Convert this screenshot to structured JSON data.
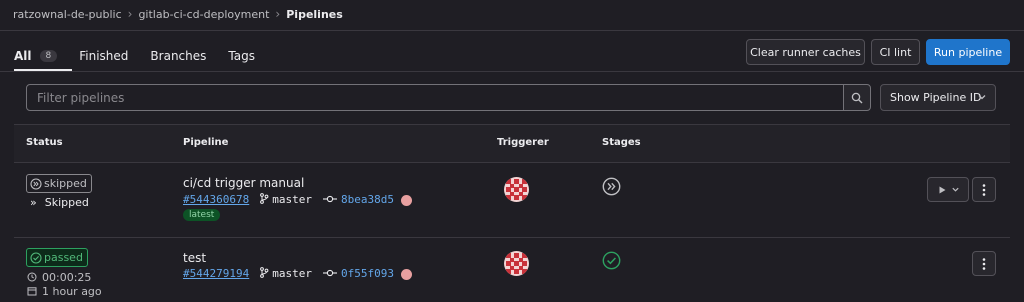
{
  "breadcrumb": {
    "items": [
      "ratzownal-de-public",
      "gitlab-ci-cd-deployment",
      "Pipelines"
    ]
  },
  "tabs": [
    {
      "label": "All",
      "count": "8",
      "active": true
    },
    {
      "label": "Finished"
    },
    {
      "label": "Branches"
    },
    {
      "label": "Tags"
    }
  ],
  "actions": {
    "clear_runner_caches": "Clear runner caches",
    "ci_lint": "CI lint",
    "run_pipeline": "Run pipeline"
  },
  "filter": {
    "placeholder": "Filter pipelines",
    "show_label": "Show Pipeline ID"
  },
  "table": {
    "headers": {
      "status": "Status",
      "pipeline": "Pipeline",
      "triggerer": "Triggerer",
      "stages": "Stages"
    },
    "rows": [
      {
        "status": "skipped",
        "status_detail": "Skipped",
        "title": "ci/cd trigger manual",
        "id": "#544360678",
        "branch": "master",
        "sha": "8bea38d5",
        "tag": "latest"
      },
      {
        "status": "passed",
        "duration": "00:00:25",
        "finished": "1 hour ago",
        "title": "test",
        "id": "#544279194",
        "branch": "master",
        "sha": "0f55f093"
      }
    ]
  },
  "colors": {
    "background": "#1f1e24",
    "primary": "#1f75cb",
    "passed": "#2da160",
    "link": "#63a6e9"
  }
}
